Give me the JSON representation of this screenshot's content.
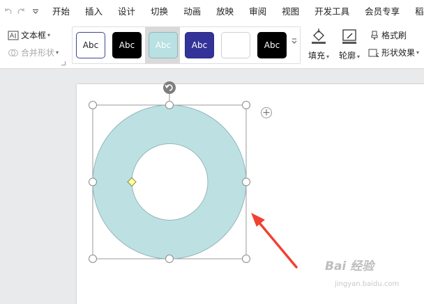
{
  "quick_access": {
    "redo_icon": "redo-icon",
    "customize_icon": "chevron-down-icon"
  },
  "menu": {
    "items": [
      "开始",
      "插入",
      "设计",
      "切换",
      "动画",
      "放映",
      "审阅",
      "视图",
      "开发工具",
      "会员专享",
      "稻壳"
    ]
  },
  "ribbon": {
    "text_box_label": "文本框",
    "merge_shape_label": "合并形状",
    "styles": [
      {
        "label": "Abc",
        "bg": "#ffffff",
        "fg": "#222222",
        "border": "#3e4495"
      },
      {
        "label": "Abc",
        "bg": "#000000",
        "fg": "#ffffff",
        "border": "#000000"
      },
      {
        "label": "Abc",
        "bg": "#b9e0e3",
        "fg": "#ffffff",
        "border": "#8fb8bb"
      },
      {
        "label": "Abc",
        "bg": "#333399",
        "fg": "#ffffff",
        "border": "#2a2a80"
      },
      {
        "label": "",
        "bg": "#ffffff",
        "fg": "#222222",
        "border": "#cfcfcf"
      },
      {
        "label": "Abc",
        "bg": "#000000",
        "fg": "#ffffff",
        "border": "#000000"
      }
    ],
    "fill_label": "填充",
    "outline_label": "轮廓",
    "format_painter_label": "格式刷",
    "shape_effects_label": "形状效果"
  },
  "shape": {
    "type": "donut",
    "fill": "#bde0e3",
    "stroke": "#93b7ba"
  },
  "annotation": {
    "arrow_color": "#f04131"
  },
  "watermark": {
    "text": "Bai 经验",
    "sub": "jingyan.baidu.com"
  }
}
